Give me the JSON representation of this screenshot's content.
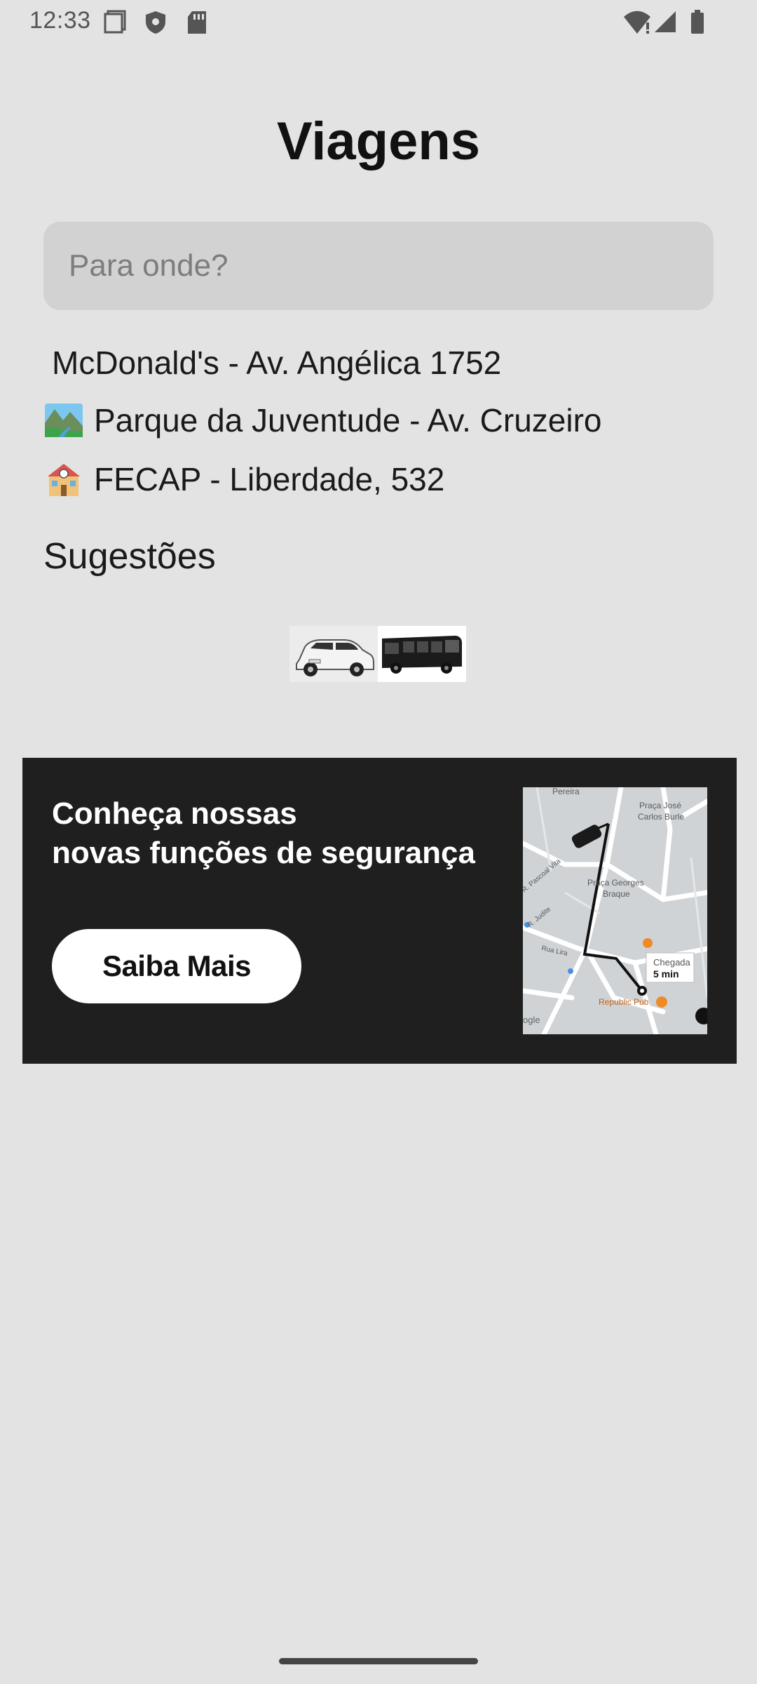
{
  "status": {
    "time": "12:33",
    "icons": [
      "screenshot-icon",
      "shield-icon",
      "sd-card-icon",
      "wifi-icon",
      "signal-icon",
      "battery-icon"
    ]
  },
  "page": {
    "title": "Viagens"
  },
  "search": {
    "placeholder": "Para onde?",
    "value": ""
  },
  "recent": [
    {
      "label": "McDonald's - Av. Angélica 1752",
      "icon": ""
    },
    {
      "label": "Parque da Juventude - Av. Cruzeiro",
      "icon": "park-icon"
    },
    {
      "label": "FECAP - Liberdade, 532",
      "icon": "school-icon"
    }
  ],
  "suggestions": {
    "title": "Sugestões",
    "items": [
      {
        "name": "car",
        "icon": "car-icon"
      },
      {
        "name": "bus",
        "icon": "bus-icon"
      }
    ]
  },
  "banner": {
    "line1": "Conheça nossas",
    "line2": "novas funções de segurança",
    "button": "Saiba Mais",
    "map": {
      "labels": [
        "Pereira",
        "Praça José",
        "Carlos Burle",
        "Praça Georges",
        "Braque",
        "R. Pascoal Vita",
        "R. Judite",
        "Rua Lira",
        "Republic Pub",
        "Chegada",
        "5 min",
        "ogle"
      ]
    }
  },
  "colors": {
    "background": "#e3e3e3",
    "banner": "#1f1f1f",
    "search": "#d2d2d2"
  }
}
